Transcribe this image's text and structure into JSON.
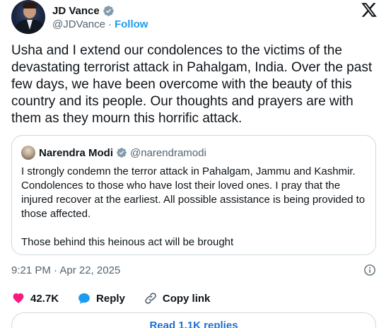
{
  "author": {
    "display_name": "JD Vance",
    "handle": "@JDVance",
    "separator": "·",
    "follow_label": "Follow"
  },
  "platform_icon": "x-logo-icon",
  "post": {
    "text": "Usha and I extend our condolences to the victims of the devastating terrorist attack in Pahalgam, India. Over the past few days, we have been overcome with the beauty of this country and its people. Our thoughts and prayers are with them as they mourn this horrific attack."
  },
  "quoted_post": {
    "display_name": "Narendra Modi",
    "handle": "@narendramodi",
    "paragraphs": [
      "I strongly condemn the terror attack in Pahalgam, Jammu and Kashmir. Condolences to those who have lost their loved ones. I pray that the injured recover at the earliest. All possible assistance is being provided to those affected.",
      "Those behind this heinous act will be brought"
    ]
  },
  "meta": {
    "timestamp": "9:21 PM · Apr 22, 2025",
    "info_icon": "info-icon"
  },
  "actions": {
    "like_count": "42.7K",
    "reply_label": "Reply",
    "copy_link_label": "Copy link"
  },
  "replies_button": {
    "label": "Read 1.1K replies"
  },
  "colors": {
    "accent": "#1d9bf0",
    "like": "#f91880",
    "verified": "#829aab",
    "text": "#0f1419",
    "muted": "#536471",
    "border": "#cfd9de"
  }
}
